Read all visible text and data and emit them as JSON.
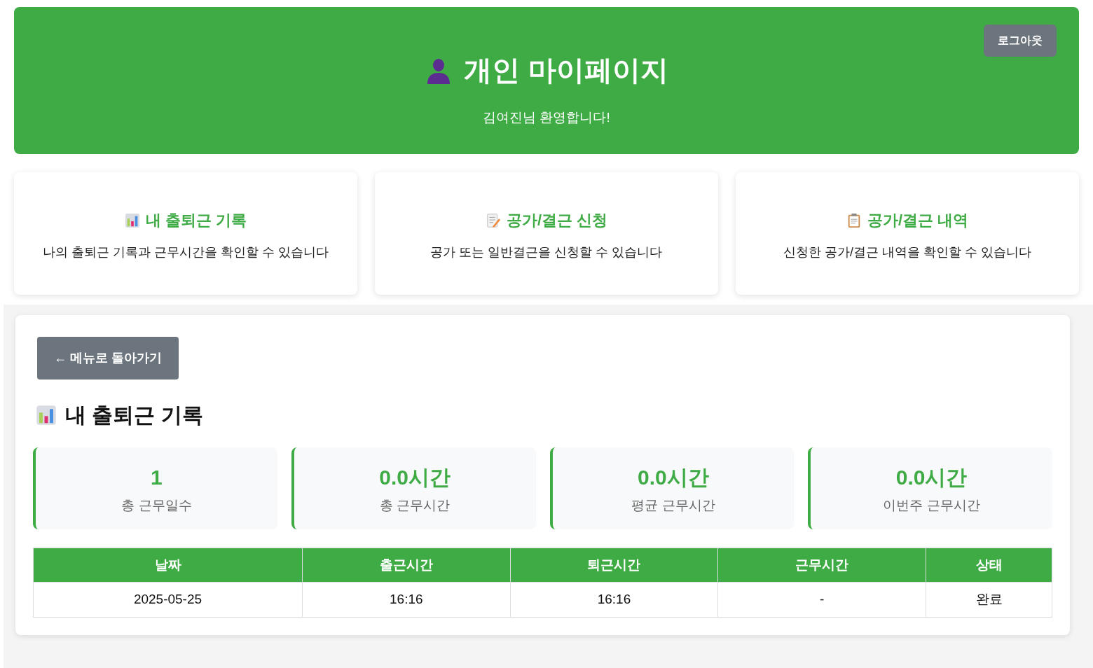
{
  "header": {
    "title": "개인 마이페이지",
    "welcome": "김여진님 환영합니다!",
    "logout": "로그아웃"
  },
  "menu_cards": [
    {
      "title": "내 출퇴근 기록",
      "description": "나의 출퇴근 기록과 근무시간을 확인할 수 있습니다"
    },
    {
      "title": "공가/결근 신청",
      "description": "공가 또는 일반결근을 신청할 수 있습니다"
    },
    {
      "title": "공가/결근 내역",
      "description": "신청한 공가/결근 내역을 확인할 수 있습니다"
    }
  ],
  "panel": {
    "back_button": "← 메뉴로 돌아가기",
    "title": "내 출퇴근 기록",
    "stats": [
      {
        "value": "1",
        "label": "총 근무일수"
      },
      {
        "value": "0.0시간",
        "label": "총 근무시간"
      },
      {
        "value": "0.0시간",
        "label": "평균 근무시간"
      },
      {
        "value": "0.0시간",
        "label": "이번주 근무시간"
      }
    ],
    "table": {
      "columns": [
        "날짜",
        "출근시간",
        "퇴근시간",
        "근무시간",
        "상태"
      ],
      "rows": [
        [
          "2025-05-25",
          "16:16",
          "16:16",
          "-",
          "완료"
        ]
      ]
    }
  }
}
